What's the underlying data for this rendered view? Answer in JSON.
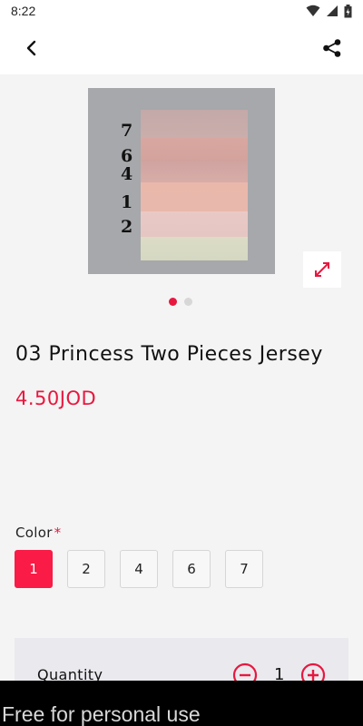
{
  "status_bar": {
    "time": "8:22",
    "icons": [
      "wifi-icon",
      "signal-icon",
      "battery-icon"
    ]
  },
  "app_bar": {
    "back_icon": "chevron-left-icon",
    "share_icon": "share-icon"
  },
  "gallery": {
    "swatch_labels": [
      "7",
      "6",
      "4",
      "1",
      "2"
    ],
    "slides_count": 2,
    "active_slide": 1,
    "expand_icon": "expand-icon"
  },
  "product": {
    "title": "03 Princess Two Pieces Jersey",
    "price": "4.50JOD"
  },
  "color": {
    "label": "Color",
    "required_mark": "*",
    "options": [
      "1",
      "2",
      "4",
      "6",
      "7"
    ],
    "selected": "1"
  },
  "quantity": {
    "label": "Quantity",
    "value": "1"
  },
  "watermark": "Free for personal use",
  "colors": {
    "accent": "#e8173f",
    "selected_chip": "#fa1b46"
  }
}
